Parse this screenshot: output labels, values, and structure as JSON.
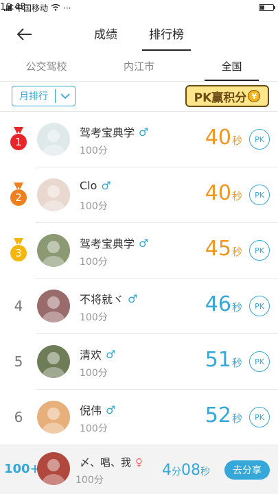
{
  "status_bar": {
    "carrier": "中国移动",
    "time": "16:48"
  },
  "header": {
    "tabs": [
      {
        "label": "成绩",
        "active": false
      },
      {
        "label": "排行榜",
        "active": true
      }
    ]
  },
  "region_tabs": [
    {
      "label": "公交驾校",
      "active": false
    },
    {
      "label": "内江市",
      "active": false
    },
    {
      "label": "全国",
      "active": true
    }
  ],
  "filter": {
    "label": "月排行"
  },
  "pk_badge": {
    "label": "PK赢积分",
    "coin": "¥"
  },
  "ranking": [
    {
      "rank": "1",
      "medal": "red",
      "name": "驾考宝典学",
      "gender": "♂",
      "score": "100分",
      "time": "40",
      "unit": "秒",
      "time_color": "orange",
      "pk": "PK",
      "avatar_color": "#dfe9ea"
    },
    {
      "rank": "2",
      "medal": "orange",
      "name": "Clo",
      "gender": "♂",
      "score": "100分",
      "time": "40",
      "unit": "秒",
      "time_color": "orange",
      "pk": "PK",
      "avatar_color": "#e9d8cf"
    },
    {
      "rank": "3",
      "medal": "yellow",
      "name": "驾考宝典学",
      "gender": "♂",
      "score": "100分",
      "time": "45",
      "unit": "秒",
      "time_color": "orange",
      "pk": "PK",
      "avatar_color": "#8b9a73"
    },
    {
      "rank": "4",
      "medal": "",
      "name": "不将就ヾ",
      "gender": "♂",
      "score": "100分",
      "time": "46",
      "unit": "秒",
      "time_color": "blue",
      "pk": "PK",
      "avatar_color": "#9a6b6b"
    },
    {
      "rank": "5",
      "medal": "",
      "name": "清欢",
      "gender": "♂",
      "score": "100分",
      "time": "51",
      "unit": "秒",
      "time_color": "blue",
      "pk": "PK",
      "avatar_color": "#6e7d58"
    },
    {
      "rank": "6",
      "medal": "",
      "name": "倪伟",
      "gender": "♂",
      "score": "100分",
      "time": "52",
      "unit": "秒",
      "time_color": "blue",
      "pk": "PK",
      "avatar_color": "#e7b07a"
    }
  ],
  "me": {
    "rank": "100+",
    "name": "〆、唱、我",
    "gender": "♀",
    "score": "100分",
    "time_min": "4",
    "min_unit": "分",
    "time_sec": "08",
    "sec_unit": "秒",
    "share": "去分享",
    "avatar_color": "#b0483e"
  },
  "colors": {
    "accent": "#35a7d8",
    "orange": "#f2961e",
    "gold_red": "#e8262a",
    "gold_orange": "#f07f1e",
    "gold_yellow": "#f6b60e"
  }
}
